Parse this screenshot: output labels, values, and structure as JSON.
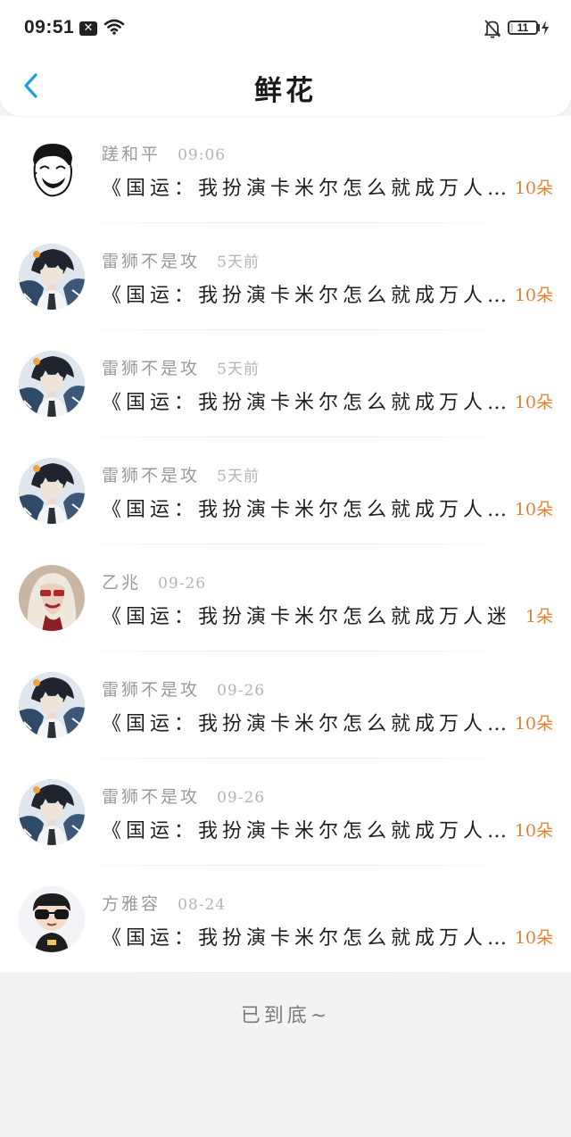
{
  "status_bar": {
    "time": "09:51",
    "notification_icon": "close-box-icon",
    "battery_level": "11",
    "battery_fraction": 0.11
  },
  "header": {
    "title": "鲜花",
    "back_icon": "chevron-left-icon",
    "accent_color": "#1e9bf0"
  },
  "gifts": [
    {
      "user": "蹉和平",
      "time": "09:06",
      "book": "《国运：我扮演卡米尔怎么就成万人…",
      "count": "10朵",
      "avatar": "meme-face"
    },
    {
      "user": "雷狮不是攻",
      "time": "5天前",
      "book": "《国运：我扮演卡米尔怎么就成万人…",
      "count": "10朵",
      "avatar": "anime-boy"
    },
    {
      "user": "雷狮不是攻",
      "time": "5天前",
      "book": "《国运：我扮演卡米尔怎么就成万人…",
      "count": "10朵",
      "avatar": "anime-boy"
    },
    {
      "user": "雷狮不是攻",
      "time": "5天前",
      "book": "《国运：我扮演卡米尔怎么就成万人…",
      "count": "10朵",
      "avatar": "anime-boy"
    },
    {
      "user": "乙兆",
      "time": "09-26",
      "book": "《国运：我扮演卡米尔怎么就成万人迷…",
      "count": "1朵",
      "avatar": "girl-photo"
    },
    {
      "user": "雷狮不是攻",
      "time": "09-26",
      "book": "《国运：我扮演卡米尔怎么就成万人…",
      "count": "10朵",
      "avatar": "anime-boy"
    },
    {
      "user": "雷狮不是攻",
      "time": "09-26",
      "book": "《国运：我扮演卡米尔怎么就成万人…",
      "count": "10朵",
      "avatar": "anime-boy"
    },
    {
      "user": "方雅容",
      "time": "08-24",
      "book": "《国运：我扮演卡米尔怎么就成万人…",
      "count": "10朵",
      "avatar": "cartoon-sunglasses"
    }
  ],
  "footer": {
    "end_text": "已到底~"
  },
  "colors": {
    "count": "#e0813a",
    "username": "#9a9a9a",
    "background": "#f3f3f3"
  }
}
